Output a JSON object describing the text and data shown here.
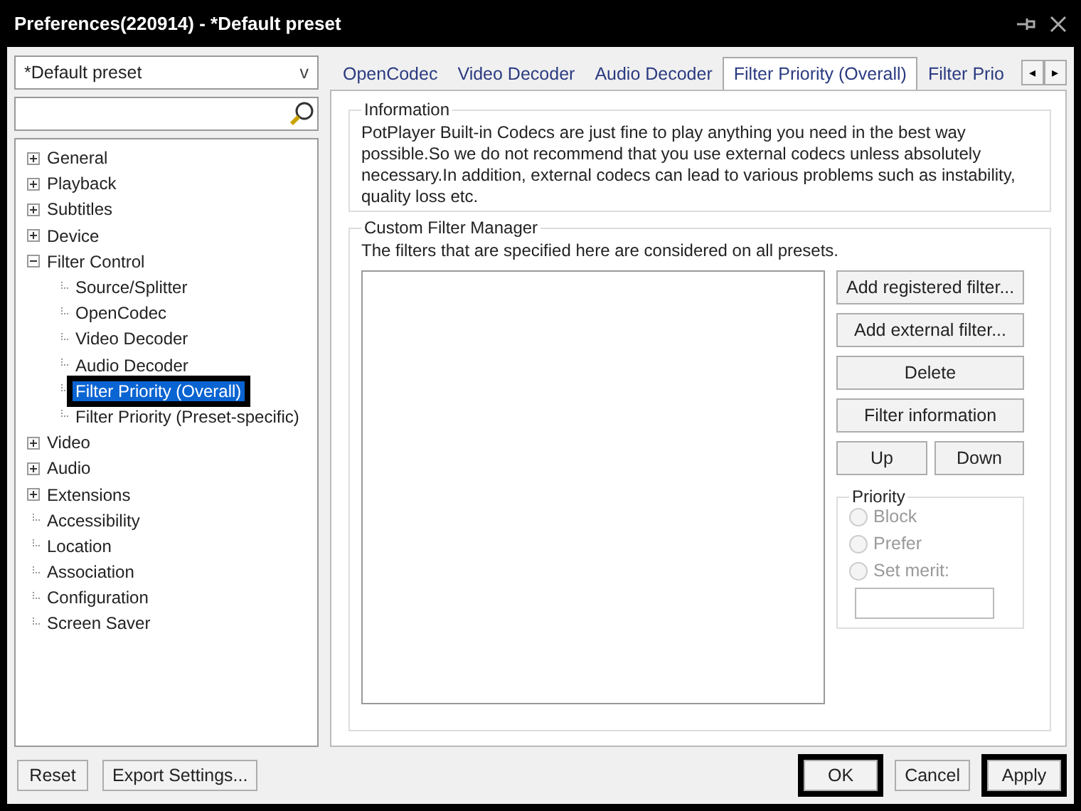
{
  "window": {
    "title": "Preferences(220914) - *Default preset"
  },
  "preset_dropdown": {
    "value": "*Default preset",
    "caret": "v"
  },
  "tree": [
    {
      "label": "General",
      "kind": "folder",
      "expanded": false,
      "selected": false,
      "highlighted": false
    },
    {
      "label": "Playback",
      "kind": "folder",
      "expanded": false,
      "selected": false,
      "highlighted": false
    },
    {
      "label": "Subtitles",
      "kind": "folder",
      "expanded": false,
      "selected": false,
      "highlighted": false
    },
    {
      "label": "Device",
      "kind": "folder",
      "expanded": false,
      "selected": false,
      "highlighted": false
    },
    {
      "label": "Filter Control",
      "kind": "folder",
      "expanded": true,
      "selected": false,
      "highlighted": false,
      "children": [
        {
          "label": "Source/Splitter",
          "kind": "leaf",
          "selected": false,
          "highlighted": false
        },
        {
          "label": "OpenCodec",
          "kind": "leaf",
          "selected": false,
          "highlighted": false
        },
        {
          "label": "Video Decoder",
          "kind": "leaf",
          "selected": false,
          "highlighted": false
        },
        {
          "label": "Audio Decoder",
          "kind": "leaf",
          "selected": false,
          "highlighted": false
        },
        {
          "label": "Filter Priority (Overall)",
          "kind": "leaf",
          "selected": true,
          "highlighted": true
        },
        {
          "label": "Filter Priority (Preset-specific)",
          "kind": "leaf",
          "selected": false,
          "highlighted": false
        }
      ]
    },
    {
      "label": "Video",
      "kind": "folder",
      "expanded": false,
      "selected": false,
      "highlighted": false
    },
    {
      "label": "Audio",
      "kind": "folder",
      "expanded": false,
      "selected": false,
      "highlighted": false
    },
    {
      "label": "Extensions",
      "kind": "folder",
      "expanded": false,
      "selected": false,
      "highlighted": false
    },
    {
      "label": "Accessibility",
      "kind": "leaf",
      "selected": false,
      "highlighted": false
    },
    {
      "label": "Location",
      "kind": "leaf",
      "selected": false,
      "highlighted": false
    },
    {
      "label": "Association",
      "kind": "leaf",
      "selected": false,
      "highlighted": false
    },
    {
      "label": "Configuration",
      "kind": "leaf",
      "selected": false,
      "highlighted": false
    },
    {
      "label": "Screen Saver",
      "kind": "leaf",
      "selected": false,
      "highlighted": false
    }
  ],
  "tabs": [
    {
      "label": "OpenCodec",
      "selected": false
    },
    {
      "label": "Video Decoder",
      "selected": false
    },
    {
      "label": "Audio Decoder",
      "selected": false
    },
    {
      "label": "Filter Priority (Overall)",
      "selected": true
    },
    {
      "label": "Filter Prio",
      "selected": false
    }
  ],
  "tab_scroll": [
    "◂",
    "▸"
  ],
  "information": {
    "title": "Information",
    "text": "PotPlayer Built-in Codecs are just fine to play anything you need in the best way possible.So we do not recommend that you use external codecs unless absolutely necessary.In addition, external codecs can lead to various problems such as instability, quality loss etc."
  },
  "filter_manager": {
    "title": "Custom Filter Manager",
    "note": "The filters that are specified here are considered on all presets.",
    "buttons": [
      "Add registered filter...",
      "Add external filter...",
      "Delete",
      "Filter information"
    ],
    "move_buttons": [
      "Up",
      "Down"
    ],
    "priority": {
      "title": "Priority",
      "disabled": true,
      "options": [
        {
          "label": "Block",
          "selected": false
        },
        {
          "label": "Prefer",
          "selected": false
        },
        {
          "label": "Set merit:",
          "selected": false
        }
      ]
    }
  },
  "footer_left": [
    {
      "label": "Reset",
      "highlighted": false
    },
    {
      "label": "Export Settings...",
      "highlighted": false
    }
  ],
  "footer_right": [
    {
      "label": "OK",
      "highlighted": true
    },
    {
      "label": "Cancel",
      "highlighted": false
    },
    {
      "label": "Apply",
      "highlighted": true
    }
  ]
}
